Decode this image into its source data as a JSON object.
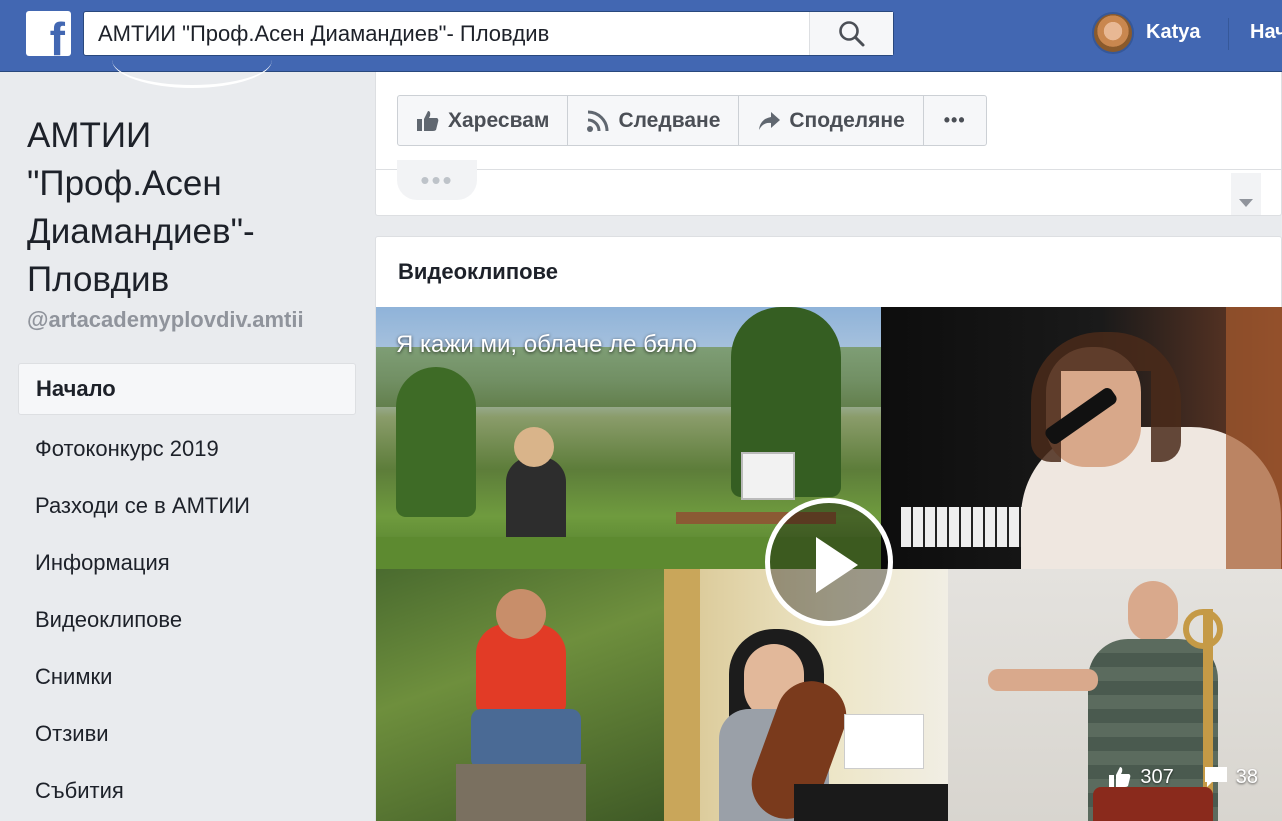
{
  "topbar": {
    "logo": "f",
    "search_value": "АМТИИ \"Проф.Асен Диамандиев\"- Пловдив",
    "user_name": "Katya",
    "home_label": "Начало"
  },
  "page": {
    "name": "АМТИИ \"Проф.Асен Диамандиев\"- Пловдив",
    "handle": "@artacademyplovdiv.amtii"
  },
  "left_nav": {
    "items": [
      {
        "label": "Начало",
        "active": true
      },
      {
        "label": "Фотоконкурс 2019"
      },
      {
        "label": "Разходи се в АМТИИ"
      },
      {
        "label": "Информация"
      },
      {
        "label": "Видеоклипове"
      },
      {
        "label": "Снимки"
      },
      {
        "label": "Отзиви"
      },
      {
        "label": "Събития"
      }
    ]
  },
  "actions": {
    "like": "Харесвам",
    "follow": "Следване",
    "share": "Споделяне",
    "more": "•••"
  },
  "videos": {
    "section_title": "Видеоклипове",
    "video_title": "Я кажи ми, облаче ле бяло",
    "likes": "307",
    "comments": "38"
  },
  "colors": {
    "brand_blue": "#4267b2",
    "background": "#e9ebee"
  }
}
